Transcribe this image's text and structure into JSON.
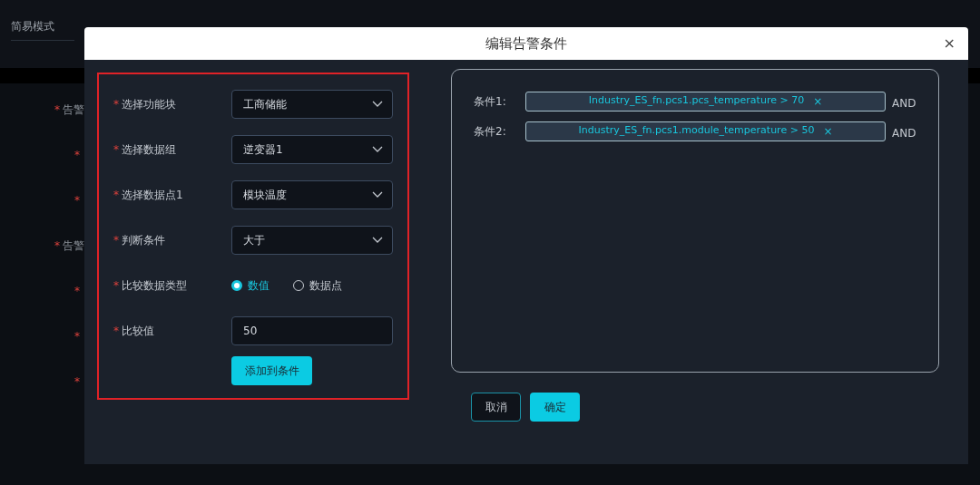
{
  "background": {
    "tabs": [
      {
        "label": "简易模式",
        "selected": false
      }
    ],
    "fields": [
      {
        "mark": "*",
        "label": "告警"
      },
      {
        "mark": "*"
      },
      {
        "mark": "*"
      },
      {
        "mark": "*",
        "label": "告警"
      },
      {
        "mark": "*"
      },
      {
        "mark": "*"
      },
      {
        "mark": "*"
      }
    ]
  },
  "dialog": {
    "title": "编辑告警条件",
    "close": "×",
    "form": [
      {
        "kind": "select",
        "mark": "*",
        "label": "选择功能块",
        "value": "工商储能"
      },
      {
        "kind": "select",
        "mark": "*",
        "label": "选择数据组",
        "value": "逆变器1"
      },
      {
        "kind": "select",
        "mark": "*",
        "label": "选择数据点1",
        "value": "模块温度"
      },
      {
        "kind": "select",
        "mark": "*",
        "label": "判断条件",
        "value": "大于"
      },
      {
        "kind": "radio",
        "mark": "*",
        "label": "比较数据类型",
        "options": [
          {
            "label": "数值",
            "selected": true
          },
          {
            "label": "数据点",
            "selected": false
          }
        ]
      },
      {
        "kind": "input",
        "mark": "*",
        "label": "比较值",
        "value": "50"
      }
    ],
    "add_button": "添加到条件",
    "conditions": [
      {
        "label": "条件1:",
        "expression": "Industry_ES_fn.pcs1.pcs_temperature > 70",
        "remove": "×",
        "joiner": "AND"
      },
      {
        "label": "条件2:",
        "expression": "Industry_ES_fn.pcs1.module_temperature > 50",
        "remove": "×",
        "joiner": "AND"
      }
    ],
    "buttons": [
      {
        "label": "取消",
        "kind": "secondary"
      },
      {
        "label": "确定",
        "kind": "primary"
      }
    ]
  }
}
